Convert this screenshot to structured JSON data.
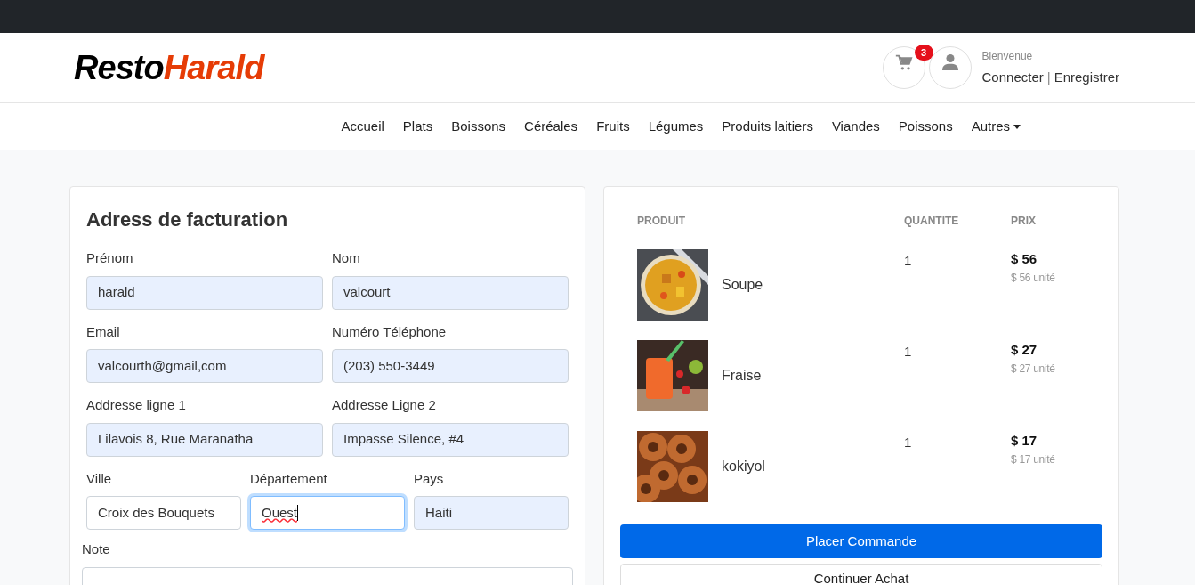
{
  "logo": {
    "part_1": "Resto",
    "part_2": "Harald"
  },
  "header": {
    "cart_count": "3",
    "greeting": "Bienvenue",
    "login": "Connecter",
    "separator": "|",
    "register": "Enregistrer"
  },
  "nav": [
    {
      "label": "Accueil",
      "dropdown": false
    },
    {
      "label": "Plats",
      "dropdown": false
    },
    {
      "label": "Boissons",
      "dropdown": false
    },
    {
      "label": "Céréales",
      "dropdown": false
    },
    {
      "label": "Fruits",
      "dropdown": false
    },
    {
      "label": "Légumes",
      "dropdown": false
    },
    {
      "label": "Produits laitiers",
      "dropdown": false
    },
    {
      "label": "Viandes",
      "dropdown": false
    },
    {
      "label": "Poissons",
      "dropdown": false
    },
    {
      "label": "Autres",
      "dropdown": true
    }
  ],
  "billing": {
    "title": "Adress de facturation",
    "rows": [
      [
        {
          "label": "Prénom",
          "value": "harald",
          "autofilled": true,
          "focused": false
        },
        {
          "label": "Nom",
          "value": "valcourt",
          "autofilled": true,
          "focused": false
        }
      ],
      [
        {
          "label": "Email",
          "value": "valcourth@gmail,com",
          "autofilled": true,
          "focused": false
        },
        {
          "label": "Numéro Téléphone",
          "value": "(203) 550-3449",
          "autofilled": true,
          "focused": false
        }
      ],
      [
        {
          "label": "Addresse ligne 1",
          "value": "Lilavois 8, Rue Maranatha",
          "autofilled": true,
          "focused": false
        },
        {
          "label": "Addresse Ligne 2",
          "value": "Impasse Silence, #4",
          "autofilled": true,
          "focused": false
        }
      ],
      [
        {
          "label": "Ville",
          "value": "Croix des Bouquets",
          "autofilled": false,
          "focused": false
        },
        {
          "label": "Département",
          "value": "Ouest",
          "autofilled": false,
          "focused": true
        },
        {
          "label": "Pays",
          "value": "Haiti",
          "autofilled": true,
          "focused": false
        }
      ]
    ],
    "note_label": "Note"
  },
  "cart": {
    "columns": [
      "PRODUIT",
      "QUANTITE",
      "PRIX"
    ],
    "items": [
      {
        "name": "Soupe",
        "quantity": "1",
        "price": "$ 56",
        "unit_price": "$ 56 unité",
        "kind": "soup"
      },
      {
        "name": "Fraise",
        "quantity": "1",
        "price": "$ 27",
        "unit_price": "$ 27 unité",
        "kind": "drink"
      },
      {
        "name": "kokiyol",
        "quantity": "1",
        "price": "$ 17",
        "unit_price": "$ 17 unité",
        "kind": "rings"
      }
    ],
    "primary_button": "Placer Commande",
    "secondary_button": "Continuer Achat"
  }
}
